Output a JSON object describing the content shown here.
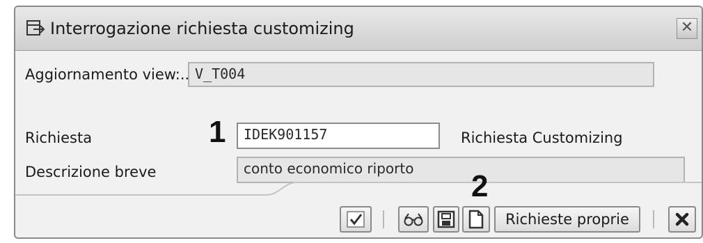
{
  "dialog": {
    "title": "Interrogazione richiesta customizing",
    "close_symbol": "✕"
  },
  "form": {
    "view_label": "Aggiornamento view:...",
    "view_value": "V_T004",
    "request_label": "Richiesta",
    "request_value": "IDEK901157",
    "request_type": "Richiesta Customizing",
    "desc_label": "Descrizione breve",
    "desc_value": "conto economico riporto"
  },
  "annotations": {
    "marker_1": "1",
    "marker_2": "2"
  },
  "toolbar": {
    "own_requests_label": "Richieste proprie"
  },
  "icons": [
    "title-window-icon",
    "checkmark-icon",
    "glasses-icon",
    "save-local-icon",
    "new-document-icon",
    "cancel-x-icon"
  ]
}
